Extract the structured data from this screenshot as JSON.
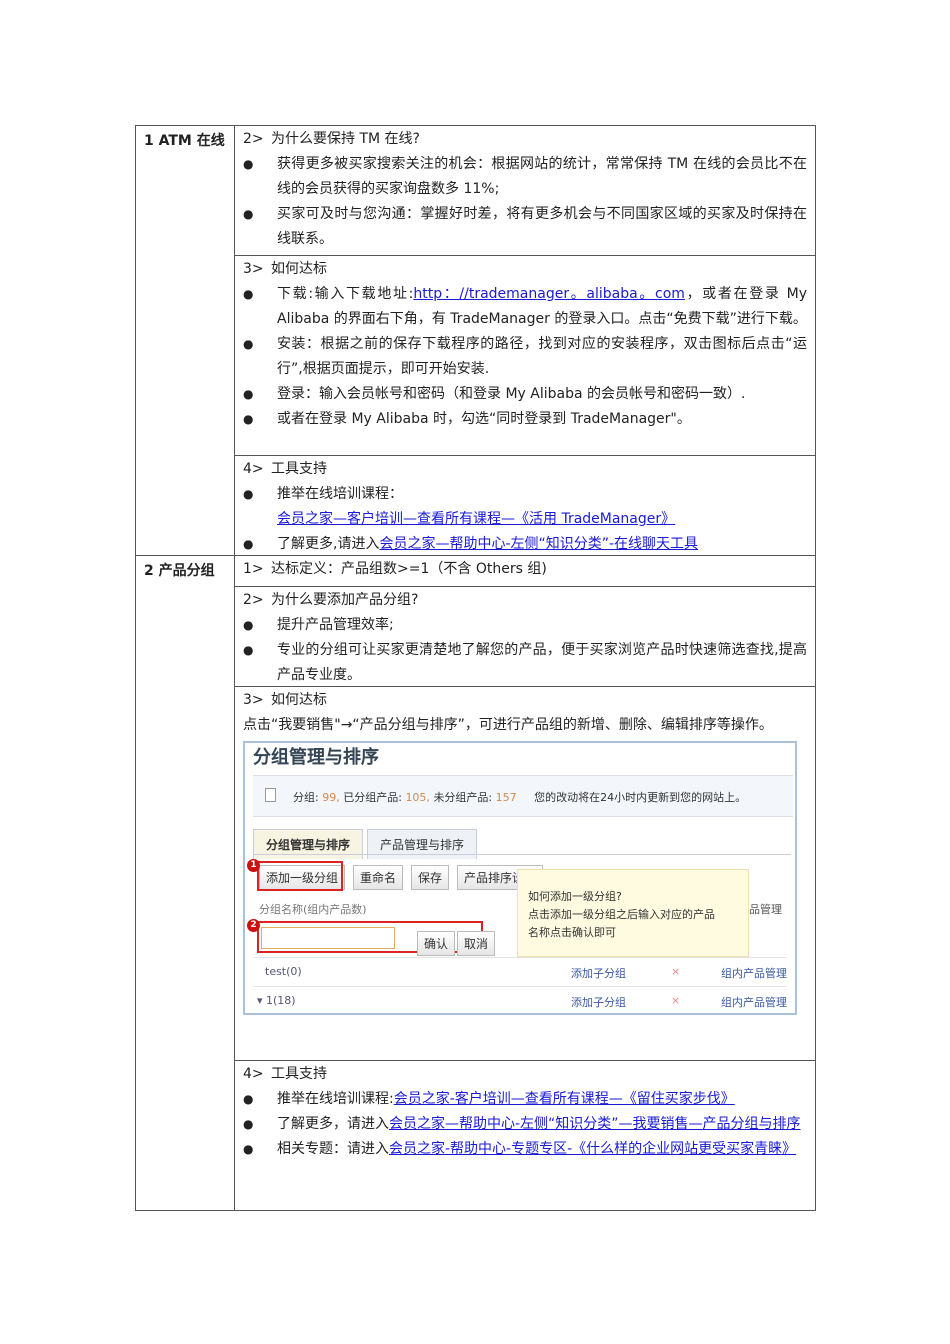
{
  "sections": [
    {
      "label": "1 ATM 在线",
      "cells": [
        {
          "num": "2>",
          "heading": "为什么要保持 TM 在线?",
          "bullets": [
            {
              "text": "获得更多被买家搜索关注的机会：根据网站的统计，常常保持 TM 在线的会员比不在线的会员获得的买家询盘数多 11%;"
            },
            {
              "text": "买家可及时与您沟通：掌握好时差，将有更多机会与不同国家区域的买家及时保持在线联系。"
            }
          ]
        },
        {
          "num": "3>",
          "heading": "如何达标",
          "bullets": [
            {
              "pre": "下载:输入下载地址:",
              "link": "http：//trademanager。alibaba。com",
              "post": "，或者在登录 My Alibaba 的界面右下角，有 TradeManager 的登录入口。点击“免费下载”进行下载。"
            },
            {
              "text": "安装：根据之前的保存下载程序的路径，找到对应的安装程序，双击图标后点击“运行”,根据页面提示，即可开始安装."
            },
            {
              "text": "登录：输入会员帐号和密码（和登录 My Alibaba 的会员帐号和密码一致）."
            },
            {
              "text": "或者在登录 My Alibaba 时，勾选“同时登录到 TradeManager\"。"
            }
          ]
        },
        {
          "num": "4>",
          "heading": "工具支持",
          "bullets": [
            {
              "pre": "推举在线培训课程：",
              "link": "会员之家—客户培训—查看所有课程—《活用 TradeManager》"
            },
            {
              "pre": "了解更多,请进入",
              "link": "会员之家—帮助中心-左侧“知识分类”-在线聊天工具"
            }
          ]
        }
      ]
    },
    {
      "label": "2 产品分组",
      "cells": [
        {
          "num": "1>",
          "heading": "达标定义：产品组数>=1（不含 Others 组)"
        },
        {
          "num": "2>",
          "heading": "为什么要添加产品分组?",
          "bullets": [
            {
              "text": "提升产品管理效率;"
            },
            {
              "text": "专业的分组可让买家更清楚地了解您的产品，便于买家浏览产品时快速筛选查找,提高产品专业度。"
            }
          ]
        },
        {
          "num": "3>",
          "heading": "如何达标",
          "para": "点击“我要销售\"→“产品分组与排序”，可进行产品组的新增、删除、编辑排序等操作。"
        },
        {
          "num": "4>",
          "heading": "工具支持",
          "bullets": [
            {
              "pre": "推举在线培训课程:",
              "link": "会员之家-客户培训—查看所有课程—《留住买家步伐》"
            },
            {
              "pre": "了解更多，请进入",
              "link": "会员之家—帮助中心-左侧“知识分类”—我要销售—产品分组与排序"
            },
            {
              "pre": "相关专题：请进入",
              "link": "会员之家-帮助中心-专题专区-《什么样的企业网站更受买家青睐》"
            }
          ]
        }
      ]
    }
  ],
  "screenshot": {
    "title": "分组管理与排序",
    "info_groups_label": "分组:",
    "info_groups": "99,",
    "info_grouped_label": "已分组产品:",
    "info_grouped": "105,",
    "info_ungrouped_label": "未分组产品:",
    "info_ungrouped": "157",
    "info_note": "您的改动将在24小时内更新到您的网站上。",
    "tabs": [
      "分组管理与排序",
      "产品管理与排序"
    ],
    "buttons": [
      "添加一级分组",
      "重命名",
      "保存",
      "产品排序设置"
    ],
    "column_header": "分组名称(组内产品数)",
    "column_right": "品管理",
    "confirm": "确认",
    "cancel": "取消",
    "badge1": "1",
    "badge2": "2",
    "tip_title": "如何添加一级分组?",
    "tip_body": "点击添加一级分组之后输入对应的产品名称点击确认即可",
    "rows": [
      {
        "name": "test(0)",
        "add": "添加子分组",
        "del": "×",
        "manage": "组内产品管理"
      },
      {
        "name": "▾ 1(18)",
        "add": "添加子分组",
        "del": "×",
        "manage": "组内产品管理"
      }
    ],
    "colors": {
      "accent_red": "#dd2222",
      "link": "#1a1ad6",
      "number": "#d08a50"
    }
  }
}
